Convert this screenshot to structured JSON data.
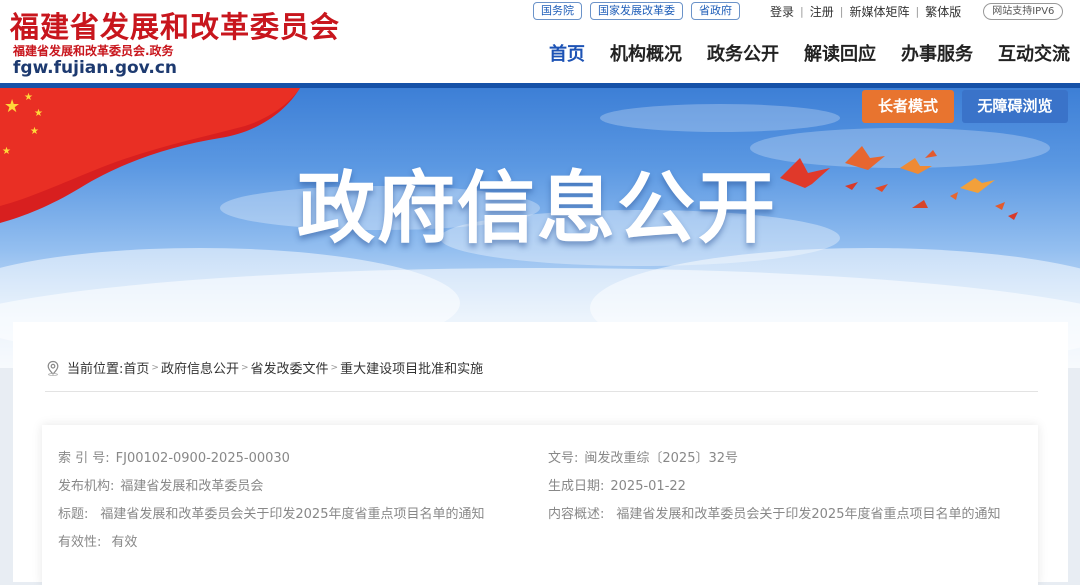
{
  "header": {
    "logo_title": "福建省发展和改革委员会",
    "logo_subtitle": "福建省发展和改革委员会.政务",
    "logo_domain": "fgw.fujian.gov.cn",
    "quick_links": [
      "国务院",
      "国家发展改革委",
      "省政府"
    ],
    "utility_links": [
      "登录",
      "注册",
      "新媒体矩阵",
      "繁体版"
    ],
    "ipv6_label": "网站支持IPV6",
    "nav": [
      "首页",
      "机构概况",
      "政务公开",
      "解读回应",
      "办事服务",
      "互动交流"
    ],
    "active_nav": "首页",
    "accent_color": "#1652a8",
    "brand_red": "#c8161d"
  },
  "banner": {
    "title": "政府信息公开",
    "elder_mode": "长者模式",
    "accessibility_mode": "无障碍浏览"
  },
  "breadcrumb": {
    "label": "当前位置:",
    "items": [
      "首页",
      "政府信息公开",
      "省发改委文件",
      "重大建设项目批准和实施"
    ]
  },
  "info": {
    "index_label": "索 引 号:",
    "index_value": "FJ00102-0900-2025-00030",
    "doc_no_label": "文号:",
    "doc_no_value": "闽发改重综〔2025〕32号",
    "publisher_label": "发布机构:",
    "publisher_value": "福建省发展和改革委员会",
    "date_label": "生成日期:",
    "date_value": "2025-01-22",
    "title_label": "标题:",
    "title_value": "福建省发展和改革委员会关于印发2025年度省重点项目名单的通知",
    "summary_label": "内容概述:",
    "summary_value": "福建省发展和改革委员会关于印发2025年度省重点项目名单的通知",
    "validity_label": "有效性:",
    "validity_value": "有效"
  }
}
